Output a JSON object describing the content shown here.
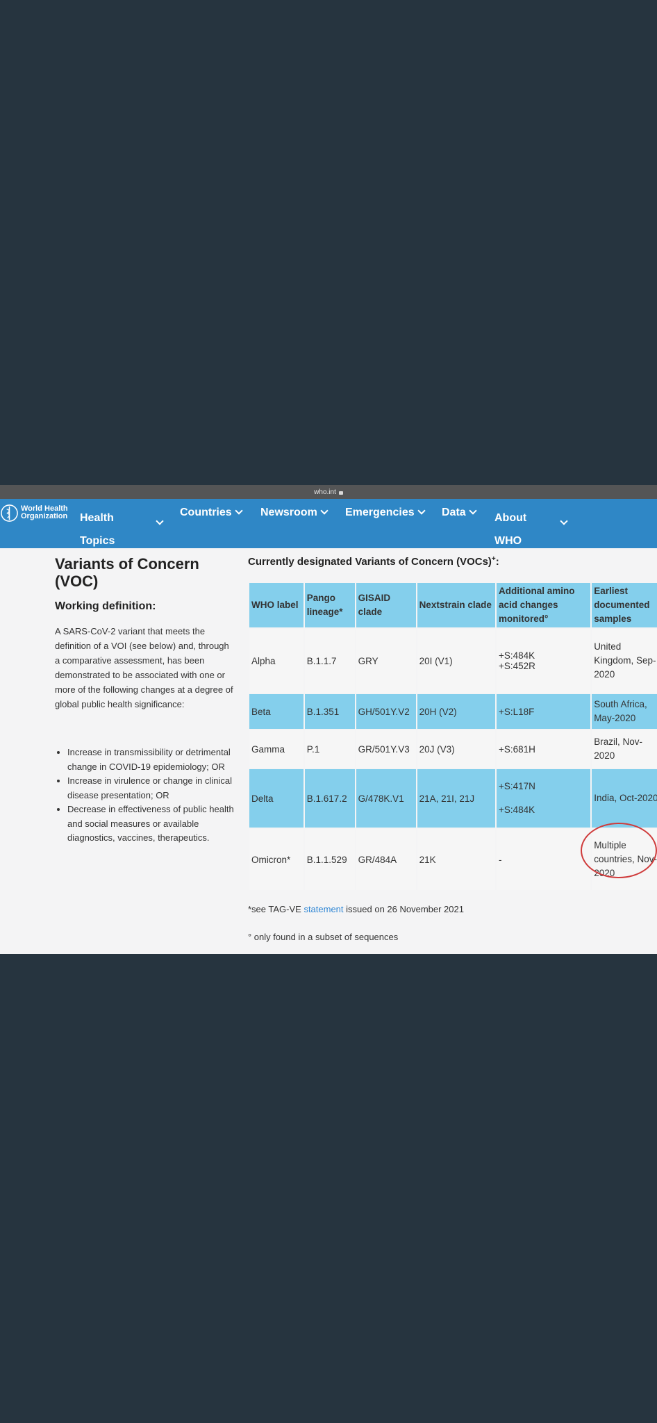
{
  "browser": {
    "url": "who.int"
  },
  "nav": {
    "logo_line1": "World Health",
    "logo_line2": "Organization",
    "items": [
      {
        "label_line1": "Health",
        "label_line2": "Topics"
      },
      {
        "label": "Countries"
      },
      {
        "label": "Newsroom"
      },
      {
        "label": "Emergencies"
      },
      {
        "label": "Data"
      },
      {
        "label_line1": "About",
        "label_line2": "WHO"
      }
    ]
  },
  "left": {
    "title_line1": "Variants of Concern",
    "title_line2": "(VOC)",
    "subtitle": "Working definition:",
    "description": "A SARS-CoV-2 variant that meets the definition of a VOI (see below) and, through a comparative assessment, has been demonstrated to be associated with one or more of the following changes at a degree of global public health significance:",
    "bullets": [
      "Increase in transmissibility or detrimental change in COVID-19 epidemiology; OR",
      "Increase in virulence or change in clinical disease presentation; OR",
      "Decrease in effectiveness of public health and social measures or available diagnostics, vaccines, therapeutics."
    ]
  },
  "table": {
    "title": "Currently designated Variants of Concern (VOCs)",
    "title_sup": "+",
    "title_end": ":",
    "headers": [
      "WHO label",
      "Pango lineage*",
      "GISAID clade",
      "Nextstrain clade",
      "Additional amino acid changes monitored°",
      "Earliest documented samples"
    ],
    "rows": [
      {
        "label": "Alpha",
        "pango": "B.1.1.7",
        "gisaid": "GRY",
        "nextstrain": "20I (V1)",
        "amino": [
          "+S:484K",
          "+S:452R"
        ],
        "samples": "United Kingdom, Sep-2020"
      },
      {
        "label": "Beta",
        "pango": "B.1.351",
        "gisaid": "GH/501Y.V2",
        "nextstrain": "20H (V2)",
        "amino": [
          "+S:L18F"
        ],
        "samples": "South Africa, May-2020"
      },
      {
        "label": "Gamma",
        "pango": "P.1",
        "gisaid": "GR/501Y.V3",
        "nextstrain": "20J (V3)",
        "amino": [
          "+S:681H"
        ],
        "samples": "Brazil, Nov-2020"
      },
      {
        "label": "Delta",
        "pango": "B.1.617.2",
        "gisaid": "G/478K.V1",
        "nextstrain": "21A, 21I, 21J",
        "amino": [
          "+S:417N",
          "+S:484K"
        ],
        "samples": "India, Oct-2020"
      },
      {
        "label": "Omicron*",
        "pango": "B.1.1.529",
        "gisaid": "GR/484A",
        "nextstrain": "21K",
        "amino": [
          "-"
        ],
        "samples": "Multiple countries, Nov-2020"
      }
    ]
  },
  "footnotes": {
    "fn1_prefix": "*see TAG-VE ",
    "fn1_link": "statement",
    "fn1_suffix": " issued on 26 November 2021",
    "fn2": "° only found in a subset of sequences"
  },
  "colors": {
    "nav": "#2f87c6",
    "row_highlight": "#84cfec",
    "annotation_circle": "#cf3b3b",
    "backdrop": "#26343f"
  }
}
